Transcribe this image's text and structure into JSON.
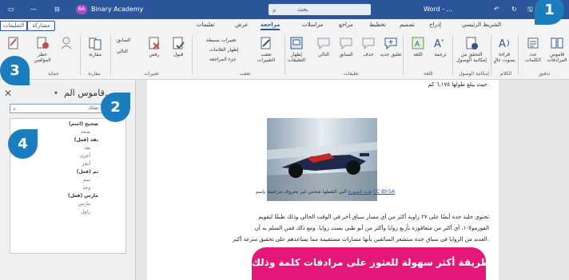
{
  "titlebar": {
    "doc_name": "Word - ...",
    "search_text": "بحث",
    "user_initials": "BA",
    "user_name": "Binary Academy"
  },
  "ribbon_tabs": {
    "comments": "التعليقات",
    "share": "مشاركة",
    "tabs": [
      "الشريط الرئيسي",
      "إدراج",
      "تصميم",
      "تخطيط",
      "مراجع",
      "مراسلات",
      "مراجعة",
      "عرض",
      "تعليمات"
    ],
    "active_index": 6
  },
  "ribbon": {
    "proofing": {
      "thesaurus": "قاموس المرادفات",
      "word_count": "عدد الكلمات",
      "group": "تدقيق"
    },
    "speech": {
      "read_aloud": "قراءة بصوت عالٍ",
      "group": "الكلام"
    },
    "accessibility": {
      "check": "التحقق من إمكانية الوصول",
      "group": "إمكانية الوصول"
    },
    "language": {
      "translate": "ترجمة",
      "language": "اللغة",
      "group": "اللغة"
    },
    "comments_group": {
      "new": "تعليق جديد",
      "delete": "حذف",
      "previous": "السابق",
      "next": "التالي",
      "show": "إظهار التعليقات",
      "group": "تعليقات"
    },
    "tracking": {
      "track": "تعقب التغييرات",
      "simple": "تغييرات بسيطة",
      "show_markup": "إظهار العلامات",
      "pane": "جزء المراجعة",
      "group": "تعقب"
    },
    "changes": {
      "accept": "قبول",
      "reject": "رفض",
      "previous": "السابق",
      "next": "التالي",
      "group": "تغييرات"
    },
    "compare": {
      "label": "مقارنة",
      "group": "مقارنة"
    },
    "protect": {
      "block": "حظر المؤلفين",
      "restrict": "تقييد التحرير",
      "group": "حماية"
    }
  },
  "pane": {
    "title": "قاموس الم...",
    "search_value": "تفكك",
    "results": [
      {
        "text": "ضجيج (اسم)",
        "head": true
      },
      {
        "text": "ضجة",
        "head": false
      },
      {
        "text": "نفذ (فعل)",
        "head": true
      },
      {
        "text": "نفذ",
        "head": false
      },
      {
        "text": "أجرى",
        "head": false
      },
      {
        "text": "أنجز",
        "head": false
      },
      {
        "text": "تم (فعل)",
        "head": true
      },
      {
        "text": "تمم",
        "head": false
      },
      {
        "text": "وجد",
        "head": false
      },
      {
        "text": "مارس (فعل)",
        "head": true
      },
      {
        "text": "مارس",
        "head": false
      },
      {
        "text": "زاول",
        "head": false
      }
    ]
  },
  "document": {
    "top_line": "حيث يبلغ طولها ٦,١٧٥ كم.",
    "caption_prefix": "هذه الصورة",
    "caption_rest": " التي التقطها شخص غير معروف مرخصة بإسم ",
    "caption_license": "CC BY-SA",
    "body": [
      "تحتوي حلبة جدة أيضًا على ٢٧ زاوية أكثر من أي مسار سباق آخر في الوقت الحالي وذلك طبقًا لتقويم",
      "الفورمولا-١، أي أكثر من متعاقوزة بأربع زوايا وأكثر من أبو ظبي بست زوايا. ومع ذلك فمن السلم به أن",
      "العديد من الزوايا في سباق جدة ستشعر السائقين بأنها مسارات مستقيمة مما يساعدهم على تحقيق سرعة أكبر."
    ]
  },
  "callouts": [
    "1",
    "2",
    "3",
    "4"
  ],
  "banner": "يوجد طريقة أكثر سهولة للعثور على مرادفات كلمة وذلك"
}
